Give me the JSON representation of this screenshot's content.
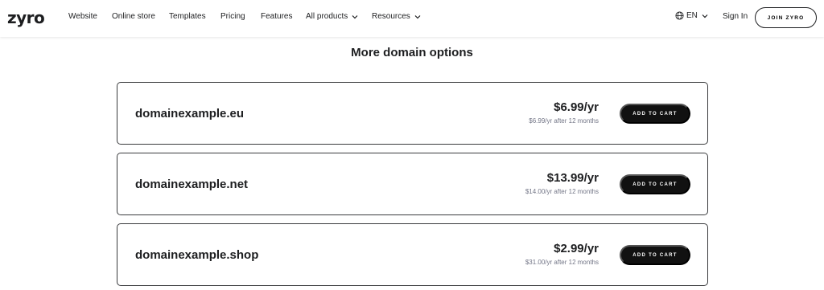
{
  "header": {
    "logo": "zyro",
    "nav": [
      {
        "label": "Website",
        "dropdown": false
      },
      {
        "label": "Online store",
        "dropdown": false
      },
      {
        "label": "Templates",
        "dropdown": false
      },
      {
        "label": "Pricing",
        "dropdown": false
      },
      {
        "label": "Features",
        "dropdown": false
      },
      {
        "label": "All products",
        "dropdown": true
      },
      {
        "label": "Resources",
        "dropdown": true
      }
    ],
    "language": "EN",
    "sign_in": "Sign In",
    "join": "JOIN ZYRO"
  },
  "main": {
    "title": "More domain options",
    "domains": [
      {
        "name": "domainexample.eu",
        "price": "$6.99/yr",
        "renewal": "$6.99/yr after 12 months",
        "button": "ADD TO CART"
      },
      {
        "name": "domainexample.net",
        "price": "$13.99/yr",
        "renewal": "$14.00/yr after 12 months",
        "button": "ADD TO CART"
      },
      {
        "name": "domainexample.shop",
        "price": "$2.99/yr",
        "renewal": "$31.00/yr after 12 months",
        "button": "ADD TO CART"
      }
    ]
  },
  "colors": {
    "text": "#1d1e20",
    "muted": "#727586",
    "button_bg": "#111111",
    "button_text": "#ffffff"
  },
  "icons": {
    "globe": "globe-icon",
    "chevron": "chevron-down-icon"
  }
}
